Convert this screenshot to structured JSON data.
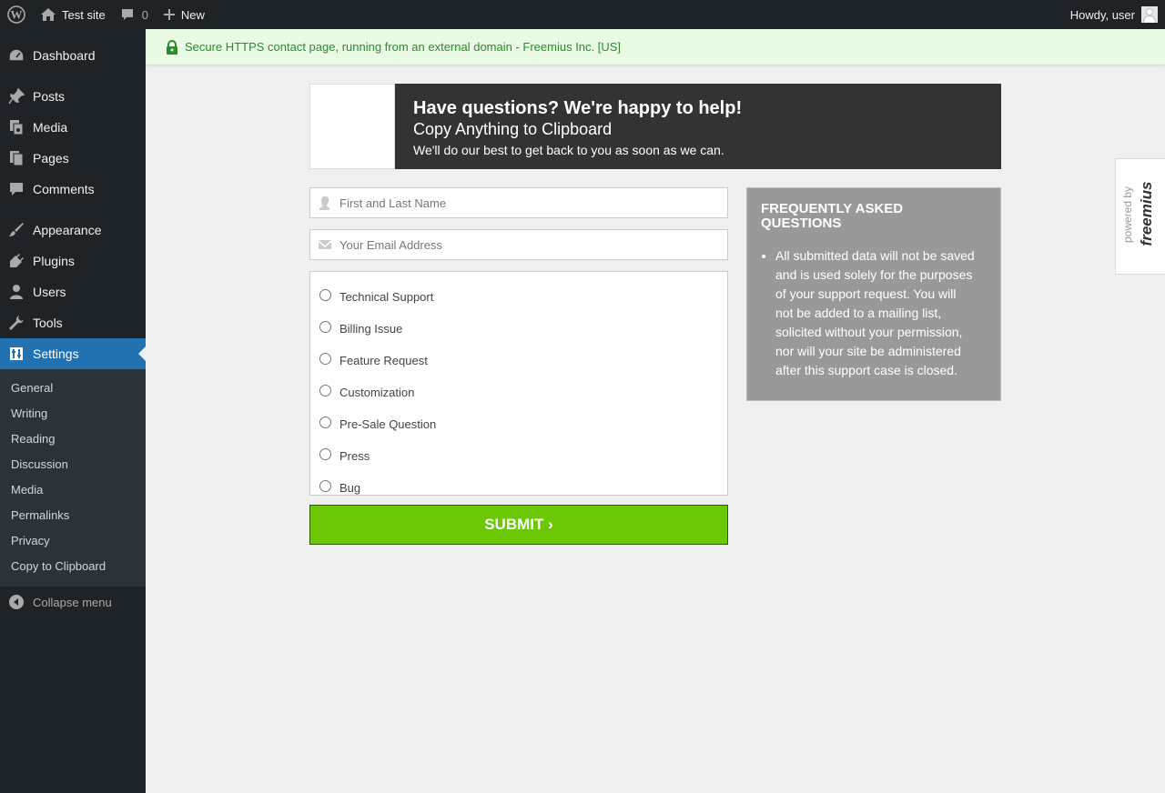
{
  "admin_bar": {
    "site_name": "Test site",
    "comments_count": "0",
    "new_label": "New",
    "greeting": "Howdy, user"
  },
  "sidebar": {
    "items": [
      {
        "label": "Dashboard",
        "icon": "dashboard-icon"
      },
      {
        "label": "Posts",
        "icon": "pin-icon"
      },
      {
        "label": "Media",
        "icon": "media-icon"
      },
      {
        "label": "Pages",
        "icon": "pages-icon"
      },
      {
        "label": "Comments",
        "icon": "comment-bubble-icon"
      },
      {
        "label": "Appearance",
        "icon": "paintbrush-icon"
      },
      {
        "label": "Plugins",
        "icon": "plug-icon"
      },
      {
        "label": "Users",
        "icon": "user-icon"
      },
      {
        "label": "Tools",
        "icon": "wrench-icon"
      },
      {
        "label": "Settings",
        "icon": "settings-sliders-icon"
      }
    ],
    "submenu": [
      "General",
      "Writing",
      "Reading",
      "Discussion",
      "Media",
      "Permalinks",
      "Privacy",
      "Copy to Clipboard"
    ],
    "collapse_label": "Collapse menu"
  },
  "notice": {
    "text": "Secure HTTPS contact page, running from an external domain - Freemius Inc. [US]",
    "color": "#2c8a2c"
  },
  "header": {
    "title": "Have questions? We're happy to help!",
    "subtitle": "Copy Anything to Clipboard",
    "description": "We'll do our best to get back to you as soon as we can."
  },
  "form": {
    "name_placeholder": "First and Last Name",
    "email_placeholder": "Your Email Address",
    "options": [
      "Technical Support",
      "Billing Issue",
      "Feature Request",
      "Customization",
      "Pre-Sale Question",
      "Press",
      "Bug"
    ],
    "submit_label": "SUBMIT ›",
    "submit_color": "#6cc704"
  },
  "faq": {
    "title": "FREQUENTLY ASKED QUESTIONS",
    "items": [
      "All submitted data will not be saved and is used solely for the purposes of your support request. You will not be added to a mailing list, solicited without your permission, nor will your site be administered after this support case is closed."
    ]
  },
  "powered_by": {
    "label": "powered by",
    "brand": "freemius"
  },
  "colors": {
    "admin_bg": "#1d2327",
    "accent": "#2271b1"
  }
}
